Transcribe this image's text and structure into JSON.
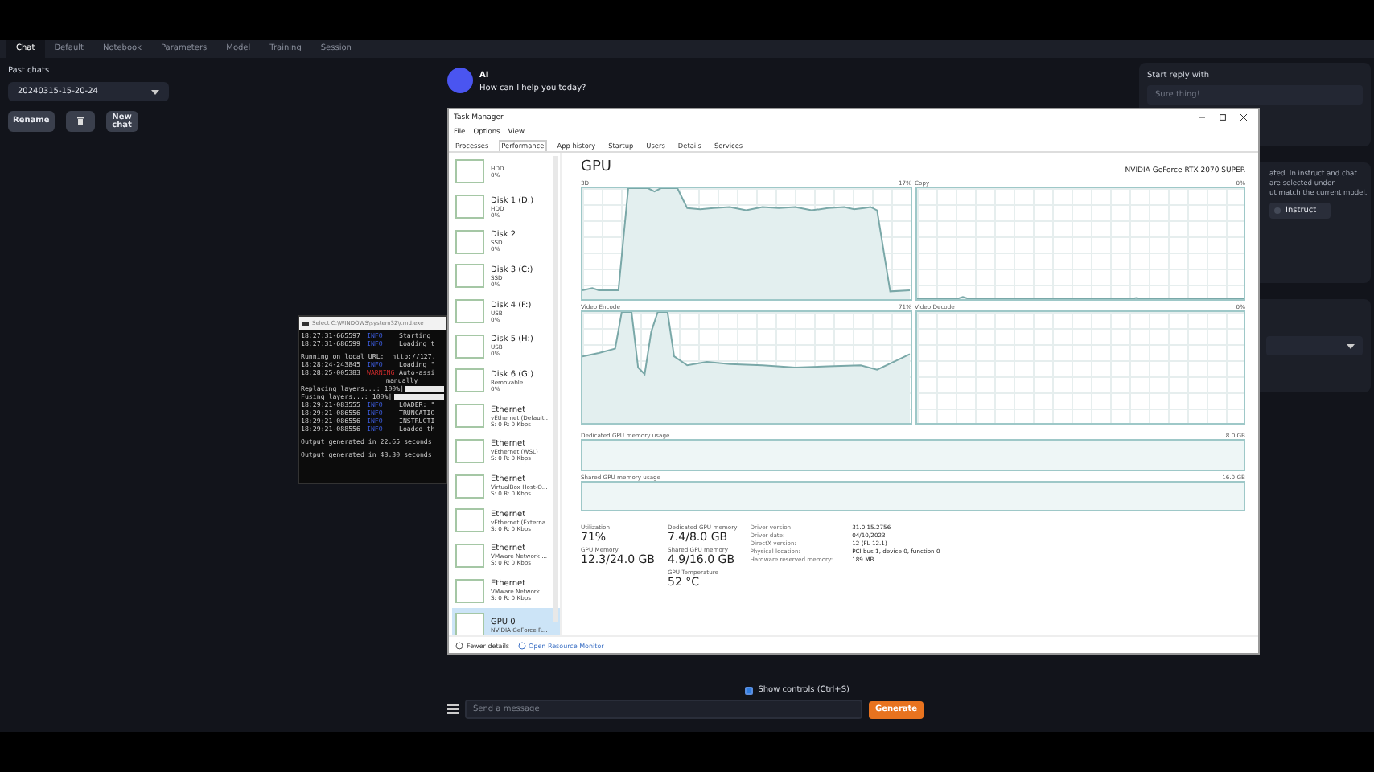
{
  "tabs": [
    {
      "label": "Chat",
      "selected": true
    },
    {
      "label": "Default",
      "selected": false
    },
    {
      "label": "Notebook",
      "selected": false
    },
    {
      "label": "Parameters",
      "selected": false
    },
    {
      "label": "Model",
      "selected": false
    },
    {
      "label": "Training",
      "selected": false
    },
    {
      "label": "Session",
      "selected": false
    }
  ],
  "past_chats": {
    "label": "Past chats",
    "value": "20240315-15-20-24"
  },
  "chat_buttons": [
    {
      "kind": "text",
      "label": "Rename"
    },
    {
      "kind": "icon"
    },
    {
      "kind": "text",
      "label": "New chat"
    }
  ],
  "message": {
    "sender": "AI",
    "text": "How can I help you today?"
  },
  "right_panel": {
    "start_reply_label": "Start reply with",
    "start_reply_placeholder": "Sure thing!",
    "note_lines": [
      "ated. In instruct and chat",
      "are selected under",
      "ut match the current model."
    ],
    "mode_option": "Instruct"
  },
  "console": {
    "title": "Select C:\\WINDOWS\\system32\\cmd.exe",
    "lines": [
      {
        "kind": "info",
        "time": "18:27:31-665597",
        "level": "INFO",
        "message": "Starting"
      },
      {
        "kind": "info",
        "time": "18:27:31-686599",
        "level": "INFO",
        "message": "Loading t"
      },
      {
        "kind": "plain",
        "text": "Running on local URL:  http://127."
      },
      {
        "kind": "info",
        "time": "18:28:24-243845",
        "level": "INFO",
        "message": "Loading \""
      },
      {
        "kind": "warning",
        "time": "18:28:25-005383",
        "level": "WARNING",
        "message": "Auto-assi"
      },
      {
        "kind": "continuation",
        "text": "manually"
      },
      {
        "kind": "progress",
        "text": "Replacing layers...: 100%|",
        "level": 1
      },
      {
        "kind": "progress",
        "text": "Fusing layers...: 100%|",
        "level": 1
      },
      {
        "kind": "info",
        "time": "18:29:21-083555",
        "level": "INFO",
        "message": "LOADER: \""
      },
      {
        "kind": "info",
        "time": "18:29:21-086556",
        "level": "INFO",
        "message": "TRUNCATIO"
      },
      {
        "kind": "info",
        "time": "18:29:21-086556",
        "level": "INFO",
        "message": "INSTRUCTI"
      },
      {
        "kind": "info",
        "time": "18:29:21-088556",
        "level": "INFO",
        "message": "Loaded th"
      },
      {
        "kind": "plain",
        "text": "Output generated in 22.65 seconds"
      },
      {
        "kind": "plain",
        "text": "Output generated in 43.30 seconds"
      }
    ]
  },
  "task_manager": {
    "title": "Task Manager",
    "menu": [
      "File",
      "Options",
      "View"
    ],
    "tabs": [
      {
        "label": "Processes",
        "selected": false
      },
      {
        "label": "Performance",
        "selected": true
      },
      {
        "label": "App history",
        "selected": false
      },
      {
        "label": "Startup",
        "selected": false
      },
      {
        "label": "Users",
        "selected": false
      },
      {
        "label": "Details",
        "selected": false
      },
      {
        "label": "Services",
        "selected": false
      }
    ],
    "devices": [
      {
        "sub": "HDD",
        "value": "0%",
        "selected": false
      },
      {
        "name": "Disk 1 (D:)",
        "sub": "HDD",
        "value": "0%",
        "selected": false
      },
      {
        "name": "Disk 2",
        "sub": "SSD",
        "value": "0%",
        "selected": false
      },
      {
        "name": "Disk 3 (C:)",
        "sub": "SSD",
        "value": "0%",
        "selected": false
      },
      {
        "name": "Disk 4 (F:)",
        "sub": "USB",
        "value": "0%",
        "selected": false
      },
      {
        "name": "Disk 5 (H:)",
        "sub": "USB",
        "value": "0%",
        "selected": false
      },
      {
        "name": "Disk 6 (G:)",
        "sub": "Removable",
        "value": "0%",
        "selected": false
      },
      {
        "name": "Ethernet",
        "sub": "vEthernet (Default...",
        "value": "S: 0 R: 0 Kbps",
        "selected": false
      },
      {
        "name": "Ethernet",
        "sub": "vEthernet (WSL)",
        "value": "S: 0 R: 0 Kbps",
        "selected": false
      },
      {
        "name": "Ethernet",
        "sub": "VirtualBox Host-O...",
        "value": "S: 0 R: 0 Kbps",
        "selected": false
      },
      {
        "name": "Ethernet",
        "sub": "vEthernet (Externa...",
        "value": "S: 0 R: 0 Kbps",
        "selected": false
      },
      {
        "name": "Ethernet",
        "sub": "VMware Network ...",
        "value": "S: 0 R: 0 Kbps",
        "selected": false
      },
      {
        "name": "Ethernet",
        "sub": "VMware Network ...",
        "value": "S: 0 R: 0 Kbps",
        "selected": false
      },
      {
        "name": "GPU 0",
        "sub": "NVIDIA GeForce R...",
        "selected": true
      }
    ],
    "heading": "GPU",
    "gpu_name": "NVIDIA GeForce RTX 2070 SUPER",
    "graphs": [
      {
        "label": "3D",
        "reading": "17%",
        "kind": "render"
      },
      {
        "label": "Copy",
        "reading": "0%",
        "kind": "copy"
      },
      {
        "label": "Video Encode",
        "reading": "71%",
        "kind": "encode"
      },
      {
        "label": "Video Decode",
        "reading": "0%",
        "kind": "decode"
      }
    ],
    "memory_bars": [
      {
        "label": "Dedicated GPU memory usage",
        "reading": "8.0 GB"
      },
      {
        "label": "Shared GPU memory usage",
        "reading": "16.0 GB"
      }
    ],
    "stats": [
      [
        {
          "label": "Utilization",
          "value": "71%"
        },
        {
          "label": "GPU Memory",
          "value": "12.3/24.0 GB"
        }
      ],
      [
        {
          "label": "Dedicated GPU memory",
          "value": "7.4/8.0 GB"
        },
        {
          "label": "Shared GPU memory",
          "value": "4.9/16.0 GB"
        },
        {
          "label": "GPU Temperature",
          "value": "52 °C"
        }
      ]
    ],
    "details": [
      {
        "label": "Driver version:",
        "value": "31.0.15.2756"
      },
      {
        "label": "Driver date:",
        "value": "04/10/2023"
      },
      {
        "label": "DirectX version:",
        "value": "12 (FL 12.1)"
      },
      {
        "label": "Physical location:",
        "value": "PCI bus 1, device 0, function 0"
      },
      {
        "label": "Hardware reserved memory:",
        "value": "189 MB"
      }
    ],
    "footer": {
      "fewer": "Fewer details",
      "monitor": "Open Resource Monitor"
    }
  },
  "bottom": {
    "show_controls": {
      "label": "Show controls (Ctrl+S)",
      "checked": true
    },
    "input_placeholder": "Send a message",
    "generate": "Generate"
  }
}
